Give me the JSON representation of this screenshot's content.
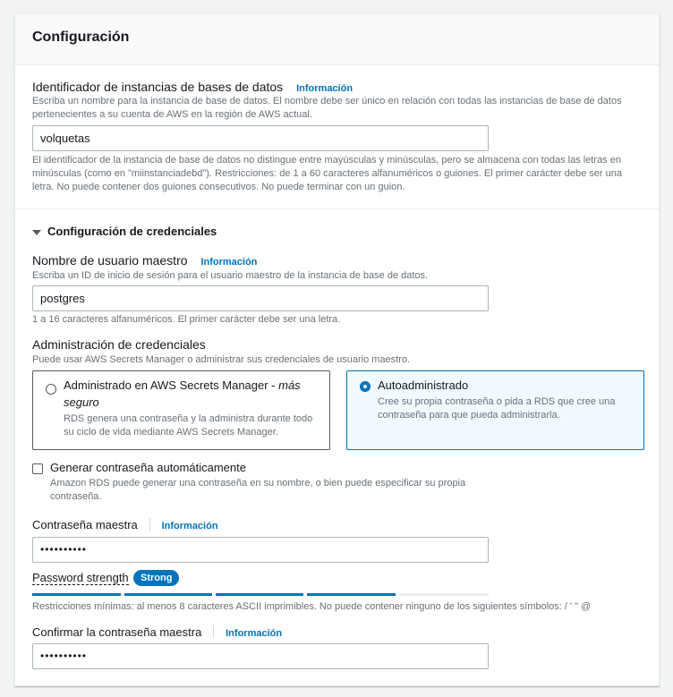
{
  "panel": {
    "title": "Configuración"
  },
  "identifier": {
    "label": "Identificador de instancias de bases de datos",
    "info": "Información",
    "description": "Escriba un nombre para la instancia de base de datos. El nombre debe ser único en relación con todas las instancias de base de datos pertenecientes a su cuenta de AWS en la región de AWS actual.",
    "value": "volquetas",
    "constraint": "El identificador de la instancia de base de datos no distingue entre mayúsculas y minúsculas, pero se almacena con todas las letras en minúsculas (como en \"miinstanciadebd\"). Restricciones: de 1 a 60 caracteres alfanuméricos o guiones. El primer carácter debe ser una letra. No puede contener dos guiones consecutivos. No puede terminar con un guion."
  },
  "credentials": {
    "section_title": "Configuración de credenciales",
    "username": {
      "label": "Nombre de usuario maestro",
      "info": "Información",
      "description": "Escriba un ID de inicio de sesión para el usuario maestro de la instancia de base de datos.",
      "value": "postgres",
      "constraint": "1 a 16 caracteres alfanuméricos. El primer carácter debe ser una letra."
    },
    "management": {
      "label": "Administración de credenciales",
      "description": "Puede usar AWS Secrets Manager o administrar sus credenciales de usuario maestro.",
      "options": [
        {
          "title": "Administrado en AWS Secrets Manager - ",
          "title_em": "más seguro",
          "description": "RDS genera una contraseña y la administra durante todo su ciclo de vida mediante AWS Secrets Manager.",
          "selected": false
        },
        {
          "title": "Autoadministrado",
          "description": "Cree su propia contraseña o pida a RDS que cree una contraseña para que pueda administrarla.",
          "selected": true
        }
      ]
    },
    "auto_password": {
      "label": "Generar contraseña automáticamente",
      "description": "Amazon RDS puede generar una contraseña en su nombre, o bien puede especificar su propia contraseña.",
      "checked": false
    },
    "master_password": {
      "label": "Contraseña maestra",
      "info": "Información",
      "value": "••••••••••"
    },
    "strength": {
      "label": "Password strength",
      "badge": "Strong",
      "level_fraction": 0.8,
      "constraint": "Restricciones mínimas: al menos 8 caracteres ASCII imprimibles. No puede contener ninguno de los siguientes símbolos: / ' \" @"
    },
    "confirm_password": {
      "label": "Confirmar la contraseña maestra",
      "info": "Información",
      "value": "••••••••••"
    }
  },
  "colors": {
    "accent": "#0073bb",
    "link": "#0073bb",
    "muted": "#687078"
  }
}
